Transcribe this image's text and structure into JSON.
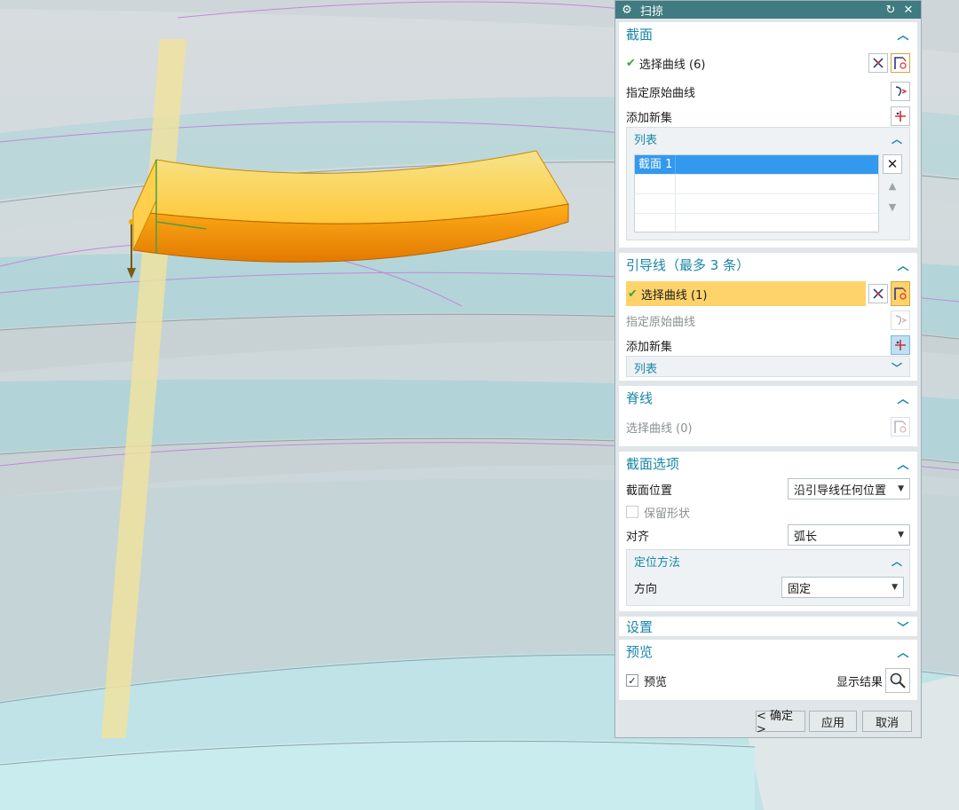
{
  "dialog": {
    "title": "扫掠",
    "reset_icon": "reset-icon",
    "close_icon": "close-icon"
  },
  "section": {
    "title": "截面",
    "select_curve": "选择曲线 (6)",
    "specify_origin": "指定原始曲线",
    "add_new_set": "添加新集",
    "list": {
      "title": "列表",
      "rows": [
        "截面 1",
        "",
        "",
        ""
      ]
    }
  },
  "guide": {
    "title": "引导线（最多 3 条）",
    "select_curve": "选择曲线 (1)",
    "specify_origin": "指定原始曲线",
    "add_new_set": "添加新集",
    "list_title": "列表"
  },
  "spine": {
    "title": "脊线",
    "select_curve": "选择曲线 (0)"
  },
  "section_options": {
    "title": "截面选项",
    "position_label": "截面位置",
    "position_value": "沿引导线任何位置",
    "keep_shape": "保留形状",
    "align_label": "对齐",
    "align_value": "弧长",
    "orientation": {
      "title": "定位方法",
      "direction_label": "方向",
      "direction_value": "固定"
    }
  },
  "settings": {
    "title": "设置"
  },
  "preview": {
    "title": "预览",
    "preview_label": "预览",
    "preview_checked": true,
    "show_result": "显示结果"
  },
  "buttons": {
    "ok": "< 确定 >",
    "apply": "应用",
    "cancel": "取消"
  },
  "colors": {
    "title_bar": "#3f7b80",
    "group_header": "#1a86a8",
    "highlight_row": "#ffd36b",
    "list_selected": "#3399ee",
    "sweep_body": "#ffb400"
  }
}
